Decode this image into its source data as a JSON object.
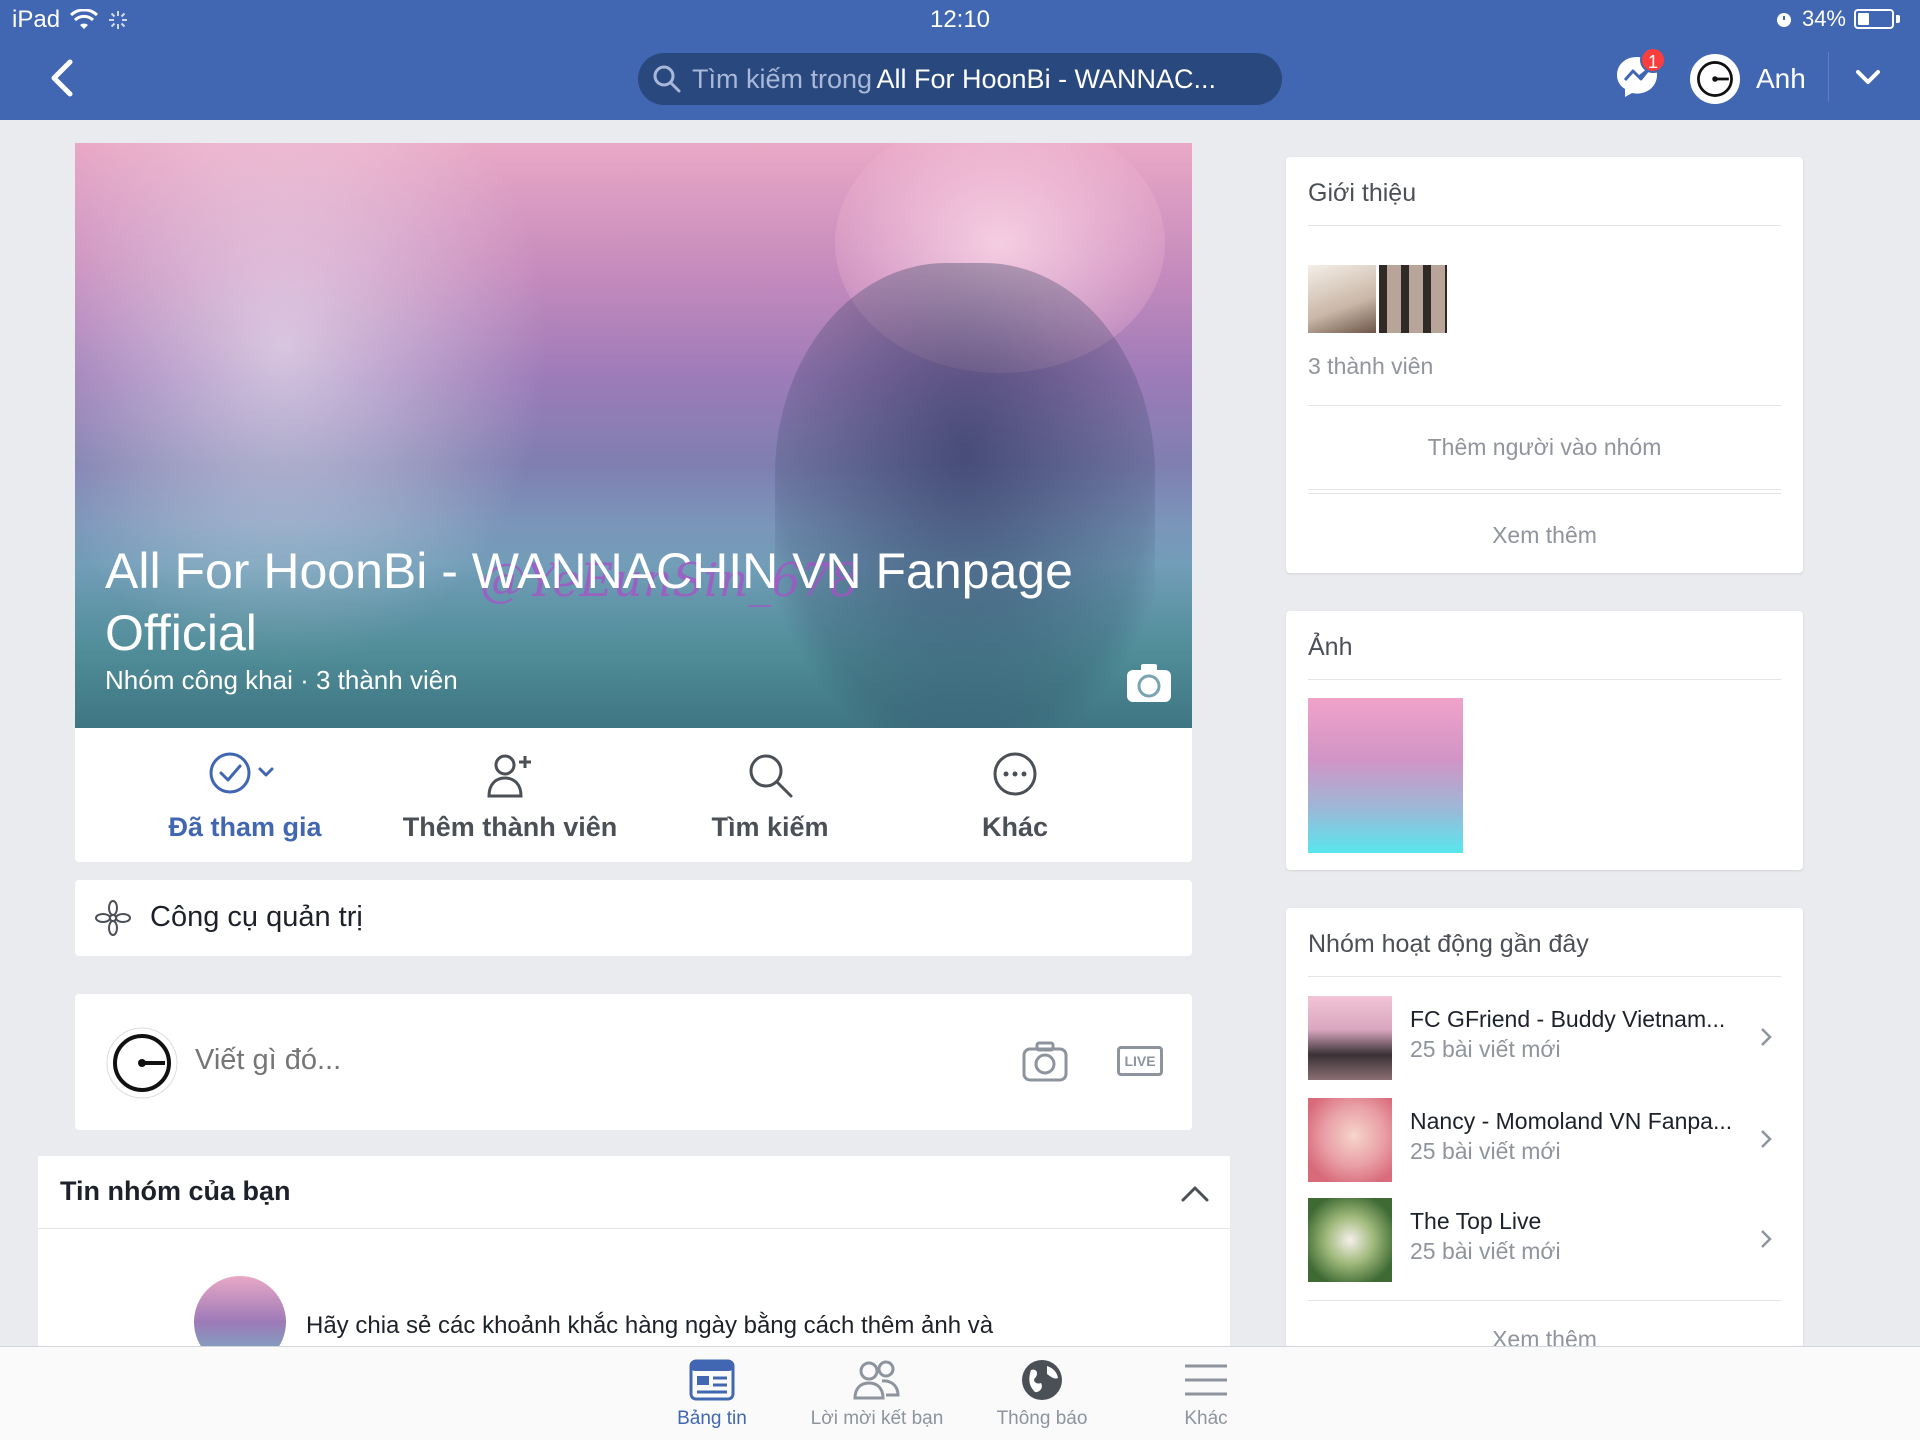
{
  "status_bar": {
    "device": "iPad",
    "time": "12:10",
    "battery": "34%"
  },
  "nav": {
    "search_placeholder": "Tìm kiếm trong",
    "search_query": "All For HoonBi - WANNAC...",
    "messenger_badge": "1",
    "user_name": "Anh"
  },
  "cover": {
    "watermark": "@YeEunSin_678",
    "title": "All For HoonBi - WANNACHIN VN Fanpage Official",
    "subtitle": "Nhóm công khai · 3 thành viên"
  },
  "actions": [
    {
      "label": "Đã tham gia",
      "icon": "check-circle-icon"
    },
    {
      "label": "Thêm thành viên",
      "icon": "add-person-icon"
    },
    {
      "label": "Tìm kiếm",
      "icon": "search-icon"
    },
    {
      "label": "Khác",
      "icon": "more-icon"
    }
  ],
  "admin_tools": {
    "label": "Công cụ quản trị"
  },
  "composer": {
    "placeholder": "Viết gì đó...",
    "live": "LIVE"
  },
  "stories": {
    "title": "Tin nhóm của bạn",
    "text": "Hãy chia sẻ các khoảnh khắc hàng ngày bằng cách thêm ảnh và"
  },
  "intro": {
    "title": "Giới thiệu",
    "member_count": "3 thành viên",
    "add_people": "Thêm người vào nhóm",
    "see_more": "Xem thêm"
  },
  "photos": {
    "title": "Ảnh"
  },
  "recent": {
    "title": "Nhóm hoạt động gần đây",
    "items": [
      {
        "name": "FC GFriend - Buddy Vietnam...",
        "sub": "25 bài viết mới"
      },
      {
        "name": "Nancy - Momoland VN Fanpa...",
        "sub": "25 bài viết mới"
      },
      {
        "name": "The Top Live",
        "sub": "25 bài viết mới"
      }
    ],
    "see_more": "Xem thêm"
  },
  "tabs": [
    {
      "label": "Bảng tin",
      "icon": "news-feed-icon"
    },
    {
      "label": "Lời mời kết bạn",
      "icon": "friends-icon"
    },
    {
      "label": "Thông báo",
      "icon": "globe-icon"
    },
    {
      "label": "Khác",
      "icon": "menu-icon"
    }
  ],
  "colors": {
    "brand": "#4267b2",
    "background": "#e9ebee",
    "badge": "#fa3e3e"
  }
}
